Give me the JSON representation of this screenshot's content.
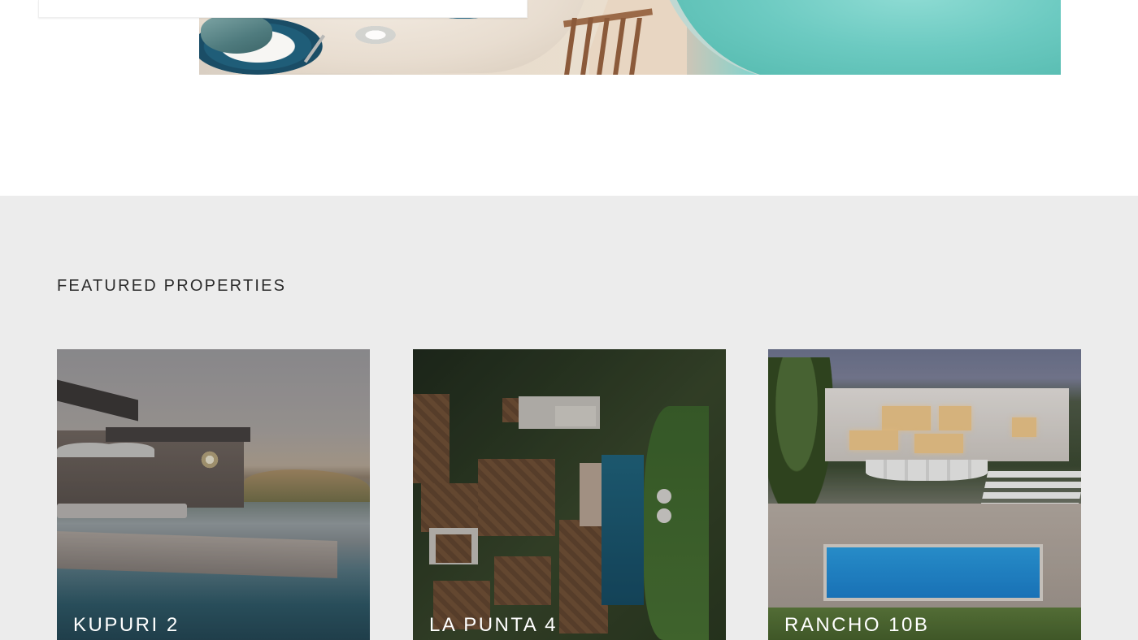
{
  "featured": {
    "title": "FEATURED PROPERTIES",
    "properties": [
      {
        "name": "KUPURI 2"
      },
      {
        "name": "LA PUNTA 4"
      },
      {
        "name": "RANCHO 10B"
      }
    ]
  }
}
